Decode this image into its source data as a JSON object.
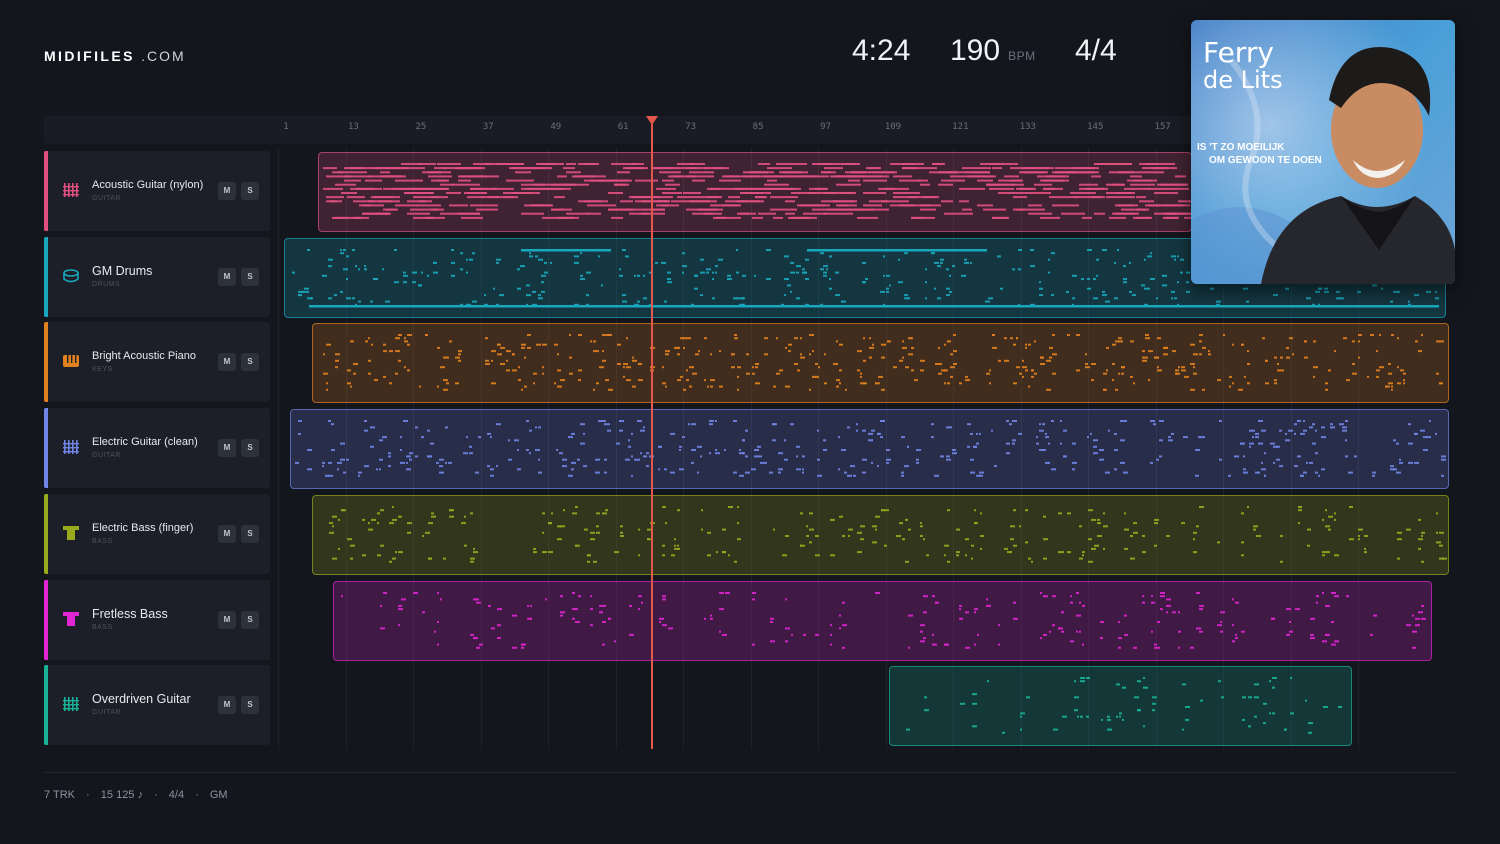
{
  "brand": {
    "name": "MIDIFILES",
    "suffix": ".COM"
  },
  "transport": {
    "time": "4:24",
    "tempo": "190",
    "tempo_unit": "BPM",
    "meter": "4/4"
  },
  "ruler": {
    "ticks": [
      "1",
      "13",
      "25",
      "37",
      "49",
      "61",
      "73",
      "85",
      "97",
      "109",
      "121",
      "133",
      "145",
      "157"
    ]
  },
  "playhead": {
    "bar": 66
  },
  "album": {
    "artist_line1": "Ferry",
    "artist_line2": "de Lits",
    "title_line1": "IS 'T ZO MOEILIJK",
    "title_line2": "OM GEWOON TE DOEN"
  },
  "tracks": [
    {
      "name": "Acoustic Guitar (nylon)",
      "category": "GUITAR",
      "color": "#e0507f",
      "icon": "guitar-grid-icon",
      "mute": "M",
      "solo": "S"
    },
    {
      "name": "GM Drums",
      "category": "DRUMS",
      "color": "#19a7bd",
      "icon": "drum-icon",
      "mute": "M",
      "solo": "S"
    },
    {
      "name": "Bright Acoustic Piano",
      "category": "KEYS",
      "color": "#e2811f",
      "icon": "piano-keys-icon",
      "mute": "M",
      "solo": "S"
    },
    {
      "name": "Electric Guitar (clean)",
      "category": "GUITAR",
      "color": "#7185e6",
      "icon": "guitar-grid-icon",
      "mute": "M",
      "solo": "S"
    },
    {
      "name": "Electric Bass (finger)",
      "category": "BASS",
      "color": "#9aaa1d",
      "icon": "bass-icon",
      "mute": "M",
      "solo": "S"
    },
    {
      "name": "Fretless Bass",
      "category": "BASS",
      "color": "#e025d2",
      "icon": "bass-icon",
      "mute": "M",
      "solo": "S"
    },
    {
      "name": "Overdriven Guitar",
      "category": "GUITAR",
      "color": "#19b299",
      "icon": "guitar-grid-icon",
      "mute": "M",
      "solo": "S"
    }
  ],
  "footer": {
    "tracks": "7 TRK",
    "notes": "15 125 ♪",
    "meter": "4/4",
    "standard": "GM",
    "sep": "·"
  }
}
